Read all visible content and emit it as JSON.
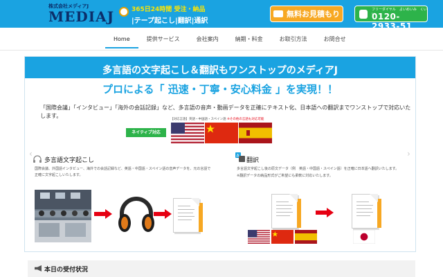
{
  "header": {
    "company": "株式会社メディアJ",
    "logo": "MEDIAJ",
    "tagline_line1": "365日24時間 受注・納品",
    "tagline_line2": "|テープ起こし|翻訳|通訳",
    "quote_button": "無料お見積もり",
    "phone_free_label": "フリーダイヤル　よいめいみ　くいい",
    "phone_number": "0120-2933-51",
    "icons": {
      "clock": "clock-icon",
      "mail": "mail-icon",
      "phone": "phone-icon"
    }
  },
  "nav": {
    "items": [
      {
        "label": "Home",
        "active": true
      },
      {
        "label": "提供サービス",
        "active": false
      },
      {
        "label": "会社案内",
        "active": false
      },
      {
        "label": "納期・料金",
        "active": false
      },
      {
        "label": "お取引方法",
        "active": false
      },
      {
        "label": "お問合せ",
        "active": false
      }
    ]
  },
  "hero": {
    "title": "多言語の文字起こし＆翻訳もワンストップのメディアJ",
    "subtitle": "プロによる「 迅速・丁寧・安心料金 」を実現！！",
    "description": "「国際会議」「インタビュー」「海外の会話記録」など、多言語の音声・動画データを正確にテキスト化、日本語への翻訳までワンストップで対応いたします。",
    "native_badge": "ネイティブ対応",
    "lang_caption": "【対応言語】英語・中国語・スペイン語",
    "lang_caption_note": "※その他の言語も対応可能",
    "transcription": {
      "title": "多言語文字起こし",
      "text": "国際会議、外国語インタビュー、海外での会話記録など、英語・中国語・スペイン語の音声データを、元の言語で正確に文字起こしいたします。"
    },
    "translation": {
      "title": "翻訳",
      "text": "多言語文字起こし後の原文データ（例　英語・中国語・スペイン語）を正確に日本語へ翻訳いたします。",
      "note": "※翻訳データの納品形式がご希望にも柔軟に対応いたします。"
    }
  },
  "status_bar": {
    "label": "本日の受付状況"
  },
  "colors": {
    "brand": "#1aa3e1",
    "orange": "#f7a823",
    "green": "#2db34a",
    "red": "#e60012"
  }
}
